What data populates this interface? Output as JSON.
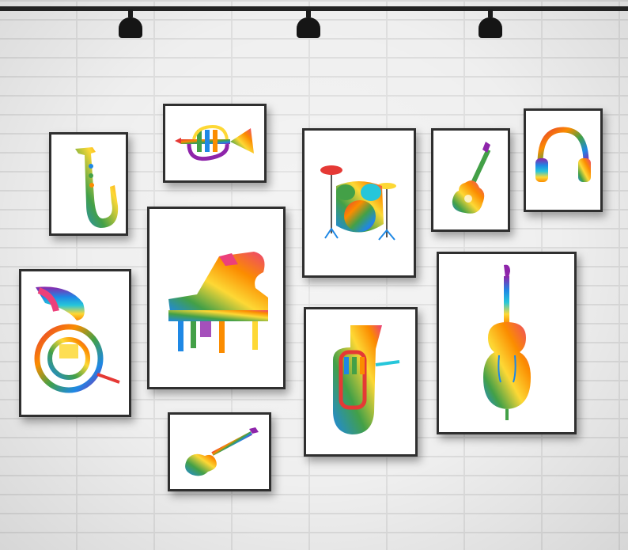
{
  "scene": {
    "subject": "watercolor-musical-instrument-prints-gallery-wall",
    "frame_color": "#2f2f2f",
    "mat_color": "#ffffff",
    "wall_color": "#efefef",
    "palette": [
      "#e53935",
      "#fb8c00",
      "#fdd835",
      "#43a047",
      "#1e88e5",
      "#8e24aa",
      "#ec407a",
      "#26c6da"
    ]
  },
  "prints": [
    {
      "id": "saxophone",
      "icon": "saxophone-icon"
    },
    {
      "id": "trumpet",
      "icon": "trumpet-icon"
    },
    {
      "id": "drum-kit",
      "icon": "drum-kit-icon"
    },
    {
      "id": "acoustic-guitar",
      "icon": "acoustic-guitar-icon"
    },
    {
      "id": "headphones",
      "icon": "headphones-icon"
    },
    {
      "id": "grand-piano",
      "icon": "grand-piano-icon"
    },
    {
      "id": "french-horn",
      "icon": "french-horn-icon"
    },
    {
      "id": "tuba",
      "icon": "tuba-icon"
    },
    {
      "id": "cello",
      "icon": "cello-icon"
    },
    {
      "id": "electric-guitar",
      "icon": "electric-guitar-icon"
    }
  ]
}
